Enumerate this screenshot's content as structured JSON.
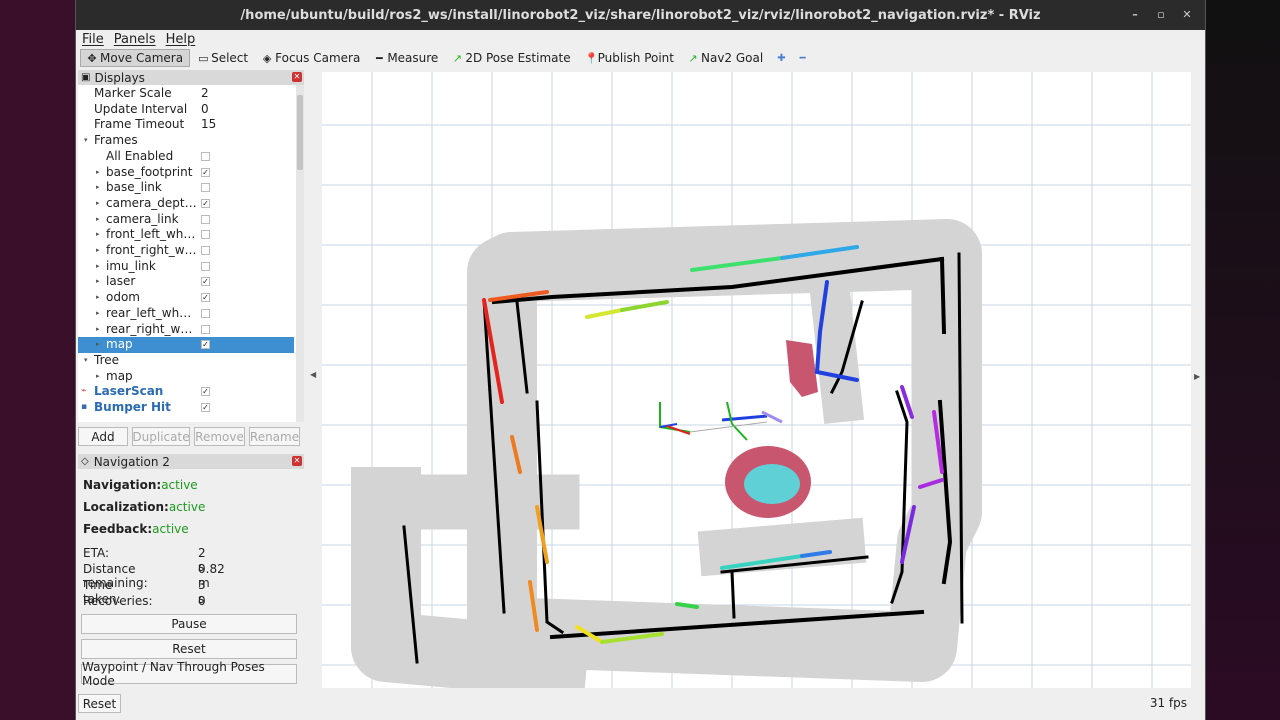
{
  "window": {
    "title": "/home/ubuntu/build/ros2_ws/install/linorobot2_viz/share/linorobot2_viz/rviz/linorobot2_navigation.rviz* - RViz",
    "controls": [
      "–",
      "▫",
      "✕"
    ]
  },
  "menu": [
    "File",
    "Panels",
    "Help"
  ],
  "toolbar": [
    {
      "label": "Move Camera",
      "icon": "move-camera-icon",
      "glyph": "✥",
      "active": true
    },
    {
      "label": "Select",
      "icon": "select-icon",
      "glyph": "▭"
    },
    {
      "label": "Focus Camera",
      "icon": "focus-camera-icon",
      "glyph": "◈"
    },
    {
      "label": "Measure",
      "icon": "measure-icon",
      "glyph": "━"
    },
    {
      "label": "2D Pose Estimate",
      "icon": "pose-estimate-icon",
      "glyph": "↗"
    },
    {
      "label": "Publish Point",
      "icon": "publish-point-icon",
      "glyph": "📍"
    },
    {
      "label": "Nav2 Goal",
      "icon": "nav-goal-icon",
      "glyph": "↗"
    }
  ],
  "displays": {
    "title": "Displays",
    "rows": [
      {
        "label": "Marker Scale",
        "value": "2",
        "indent": 0
      },
      {
        "label": "Update Interval",
        "value": "0",
        "indent": 0
      },
      {
        "label": "Frame Timeout",
        "value": "15",
        "indent": 0
      },
      {
        "label": "Frames",
        "indent": 0,
        "expander": "open"
      },
      {
        "label": "All Enabled",
        "indent": 1,
        "check": false
      },
      {
        "label": "base_footprint",
        "indent": 1,
        "check": true,
        "expander": "closed"
      },
      {
        "label": "base_link",
        "indent": 1,
        "check": false,
        "expander": "closed"
      },
      {
        "label": "camera_dept…",
        "indent": 1,
        "check": true,
        "expander": "closed"
      },
      {
        "label": "camera_link",
        "indent": 1,
        "check": false,
        "expander": "closed"
      },
      {
        "label": "front_left_wh…",
        "indent": 1,
        "check": false,
        "expander": "closed"
      },
      {
        "label": "front_right_w…",
        "indent": 1,
        "check": false,
        "expander": "closed"
      },
      {
        "label": "imu_link",
        "indent": 1,
        "check": false,
        "expander": "closed"
      },
      {
        "label": "laser",
        "indent": 1,
        "check": true,
        "expander": "closed"
      },
      {
        "label": "odom",
        "indent": 1,
        "check": true,
        "expander": "closed"
      },
      {
        "label": "rear_left_wh…",
        "indent": 1,
        "check": false,
        "expander": "closed"
      },
      {
        "label": "rear_right_w…",
        "indent": 1,
        "check": false,
        "expander": "closed"
      },
      {
        "label": "map",
        "indent": 1,
        "check": true,
        "expander": "closed",
        "selected": true
      },
      {
        "label": "Tree",
        "indent": 0,
        "expander": "open"
      },
      {
        "label": "map",
        "indent": 1,
        "expander": "closed"
      },
      {
        "label": "LaserScan",
        "indent": -1,
        "check": true,
        "display": true,
        "icon": "laserscan-icon"
      },
      {
        "label": "Bumper Hit",
        "indent": -1,
        "check": true,
        "display": true,
        "icon": "bumper-hit-icon"
      }
    ],
    "buttons": [
      {
        "label": "Add",
        "enabled": true
      },
      {
        "label": "Duplicate",
        "enabled": false
      },
      {
        "label": "Remove",
        "enabled": false
      },
      {
        "label": "Rename",
        "enabled": false
      }
    ]
  },
  "navigation": {
    "title": "Navigation 2",
    "status": [
      {
        "key": "Navigation:",
        "value": "active"
      },
      {
        "key": "Localization:",
        "value": "active"
      },
      {
        "key": "Feedback:",
        "value": "active"
      }
    ],
    "stats": [
      {
        "key": "ETA:",
        "value": "2 s"
      },
      {
        "key": "Distance remaining:",
        "value": "0.82 m"
      },
      {
        "key": "Time taken:",
        "value": "3 s"
      },
      {
        "key": "Recoveries:",
        "value": "0"
      }
    ],
    "buttons": [
      "Pause",
      "Reset",
      "Waypoint / Nav Through Poses Mode"
    ]
  },
  "status": {
    "reset_label": "Reset",
    "fps": "31 fps"
  },
  "colors": {
    "accent": "#3d8fd1",
    "active_green": "#1f9a1f",
    "costmap_gray": "#d4d4d4",
    "grid": "#c8d4e4"
  }
}
